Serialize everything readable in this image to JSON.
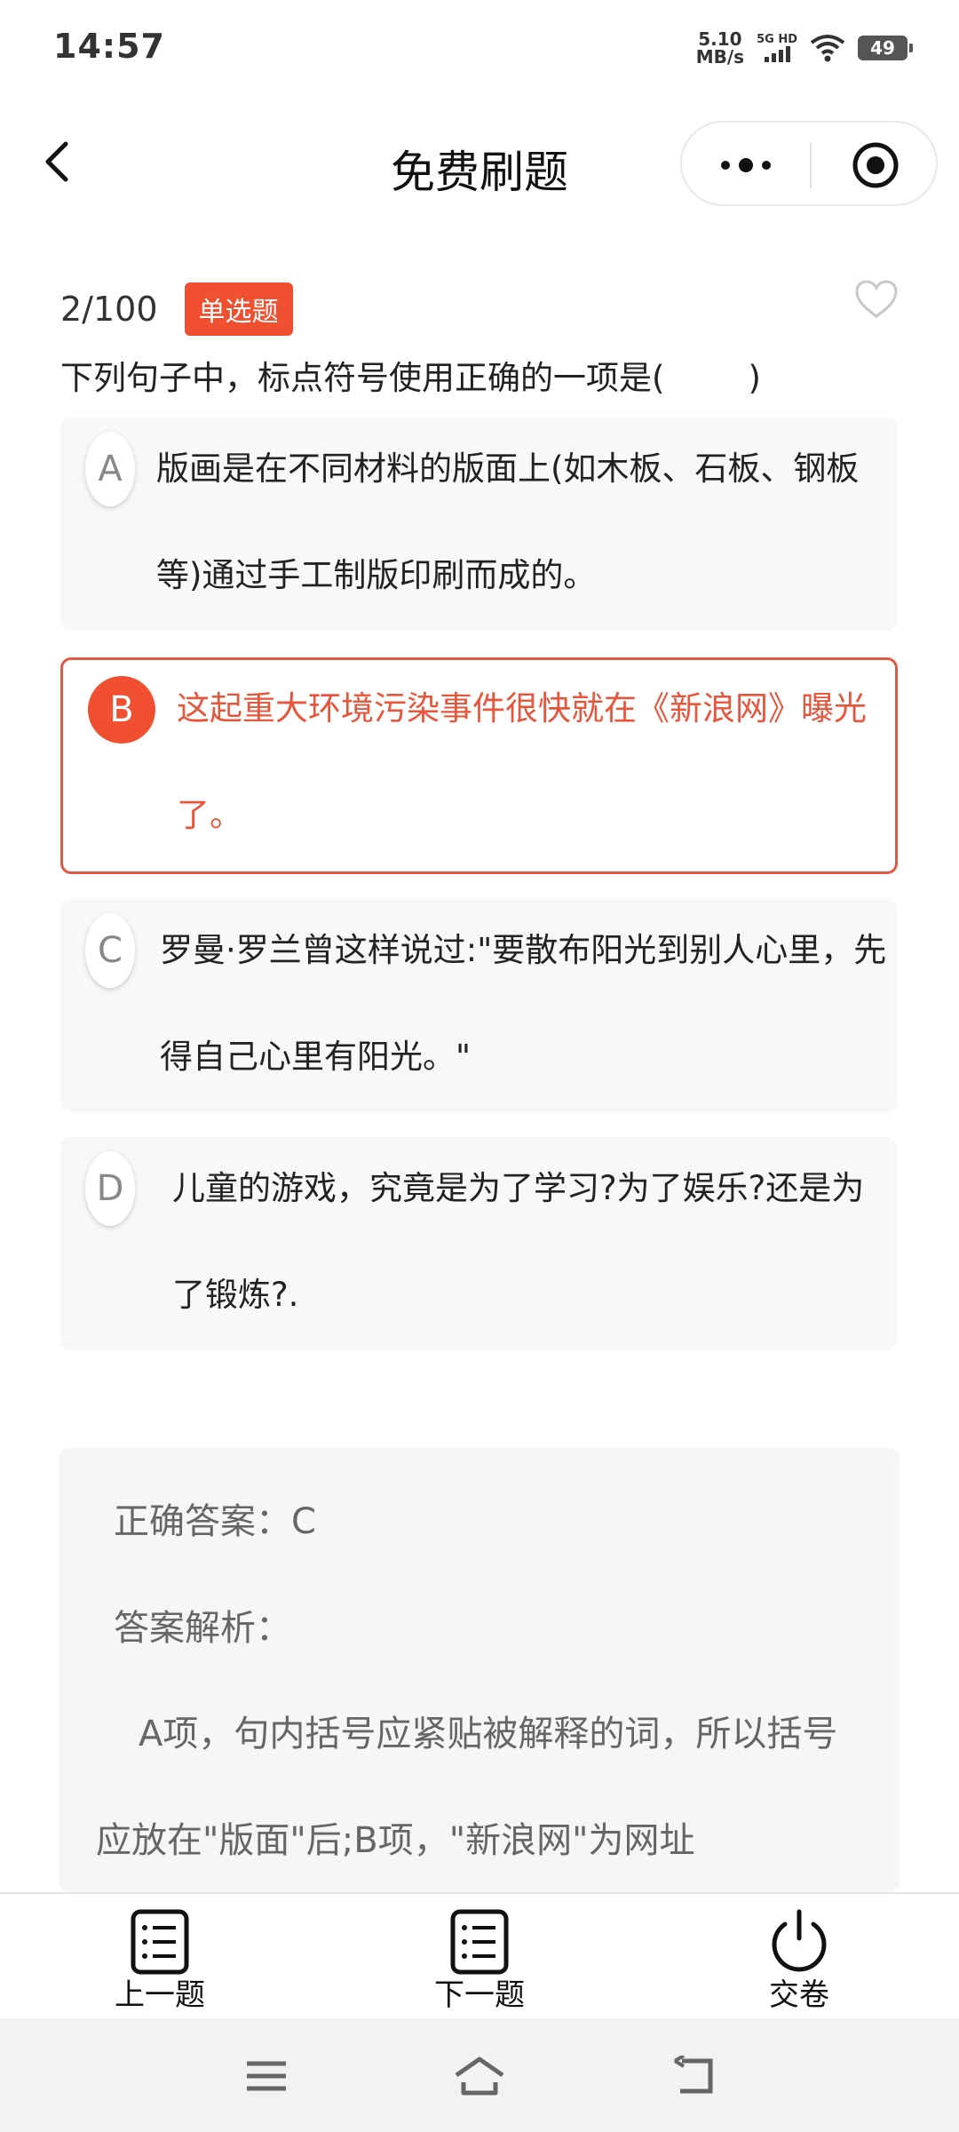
{
  "status_bar": {
    "time": "14:57",
    "net_speed_value": "5.10",
    "net_speed_unit": "MB/s",
    "signal_label": "5G HD",
    "battery": "49"
  },
  "title_bar": {
    "title": "免费刷题",
    "back_icon": "chevron-left-icon",
    "more_icon": "more-dots-icon",
    "close_icon": "target-close-icon"
  },
  "question": {
    "progress": "2/100",
    "type_badge": "单选题",
    "stem": "下列句子中，标点符号使用正确的一项是(        )",
    "options": [
      {
        "letter": "A",
        "text": "版画是在不同材料的版面上(如木板、石板、钢板等)通过手工制版印刷而成的。",
        "selected": false
      },
      {
        "letter": "B",
        "text": "这起重大环境污染事件很快就在《新浪网》曝光了。",
        "selected": true
      },
      {
        "letter": "C",
        "text": "罗曼·罗兰曾这样说过:\"要散布阳光到别人心里，先得自己心里有阳光。\"",
        "selected": false
      },
      {
        "letter": "D",
        "text": "儿童的游戏，究竟是为了学习?为了娱乐?还是为了锻炼?.",
        "selected": false
      }
    ]
  },
  "answer": {
    "correct": "正确答案：C",
    "analysis_label": "答案解析：",
    "analysis_text": "A项，句内括号应紧贴被解释的词，所以括号应放在\"版面\"后;B项，\"新浪网\"为网址"
  },
  "tab_bar": {
    "items": [
      {
        "label": "上一题",
        "icon": "list-icon"
      },
      {
        "label": "下一题",
        "icon": "list-icon"
      },
      {
        "label": "交卷",
        "icon": "power-icon"
      }
    ]
  },
  "colors": {
    "accent": "#f0502f",
    "selected_text": "#e8553b",
    "option_bg": "#f8f8f8",
    "answer_bg": "#f6f6f6"
  }
}
